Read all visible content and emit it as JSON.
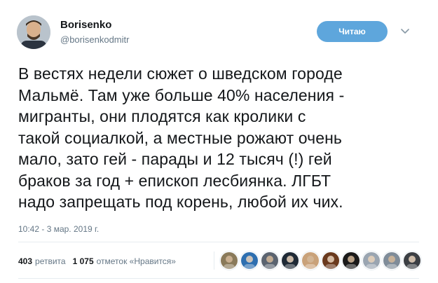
{
  "author": {
    "display_name": "Borisenko",
    "handle": "@borisenkodmitr"
  },
  "follow_button": {
    "label": "Читаю",
    "color": "#5ea6dc"
  },
  "tweet": {
    "text": "В вестях недели сюжет о шведском городе\nМальмё. Там уже больше 40% населения -\nмигранты, они плодятся как кролики с\nтакой социалкой, а местные рожают очень\nмало, зато гей - парады и 12 тысяч (!) гей\nбраков за год + епископ лесбиянка. ЛГБТ\nнадо запрещать под корень, любой их чих.",
    "timestamp": "10:42 - 3 мар. 2019 г."
  },
  "stats": {
    "retweets_count": "403",
    "retweets_label": "ретвита",
    "likes_count": "1 075",
    "likes_label": "отметок «Нравится»"
  },
  "likers": [
    {
      "icon": "liker-avatar-1",
      "color": "#8a7a5a"
    },
    {
      "icon": "liker-avatar-2",
      "color": "#2e6fb0"
    },
    {
      "icon": "liker-avatar-3",
      "color": "#5b6470"
    },
    {
      "icon": "liker-avatar-4",
      "color": "#1f2a36"
    },
    {
      "icon": "liker-avatar-5",
      "color": "#c9a27a"
    },
    {
      "icon": "liker-avatar-6",
      "color": "#6a3a1e"
    },
    {
      "icon": "liker-avatar-7",
      "color": "#1a1a1a"
    },
    {
      "icon": "liker-avatar-8",
      "color": "#9aa5b1"
    },
    {
      "icon": "liker-avatar-9",
      "color": "#7f8c99"
    },
    {
      "icon": "liker-avatar-10",
      "color": "#3b3f44"
    }
  ]
}
